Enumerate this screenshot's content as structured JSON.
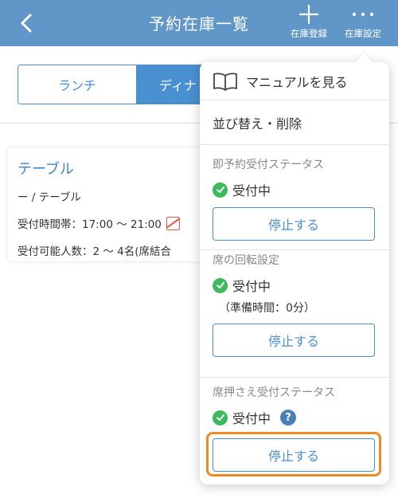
{
  "header": {
    "title": "予約在庫一覧",
    "register_label": "在庫登録",
    "settings_label": "在庫設定"
  },
  "tabs": [
    {
      "label": "ランチ",
      "selected": false
    },
    {
      "label": "ディナ",
      "selected": true
    }
  ],
  "card": {
    "title": "テーブル",
    "line1": "ー / テーブル",
    "line2": "受付時間帯：17:00 〜 21:00",
    "line3": "受付可能人数：2 〜 4名(席結合"
  },
  "menu": {
    "manual_label": "マニュアルを見る",
    "sort_label": "並び替え・削除",
    "instant": {
      "heading": "即予約受付ステータス",
      "status": "受付中",
      "stop_label": "停止する"
    },
    "rotation": {
      "heading": "席の回転設定",
      "status": "受付中",
      "prep_time": "（準備時間：0分）",
      "stop_label": "停止する"
    },
    "hold": {
      "heading": "席押さえ受付ステータス",
      "status": "受付中",
      "help_icon": "?",
      "stop_label": "停止する"
    }
  },
  "colors": {
    "header_bg": "#6096c8",
    "accent": "#4a8fd0",
    "status_green": "#3cb95a",
    "highlight": "#f08a24"
  }
}
